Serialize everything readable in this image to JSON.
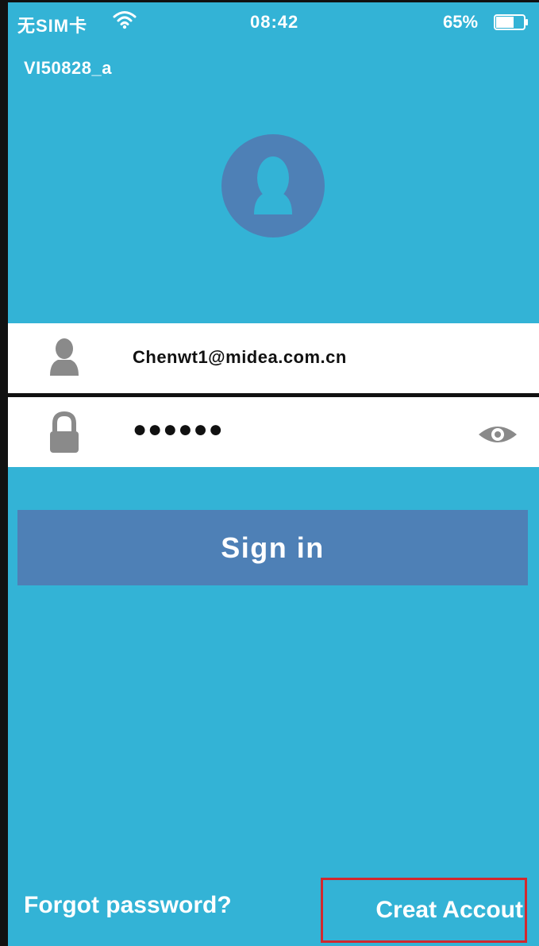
{
  "status_bar": {
    "carrier": "无SIM卡",
    "time": "08:42",
    "battery_percent": "65%",
    "battery_level": 0.65
  },
  "app": {
    "title": "VI50828_a"
  },
  "login": {
    "username_value": "Chenwt1@midea.com.cn",
    "password_masked": "●●●●●●",
    "sign_in_label": "Sign in",
    "forgot_password_label": "Forgot password?",
    "create_account_label": "Creat Accout"
  },
  "icons": {
    "avatar": "user-silhouette-icon",
    "username": "user-icon",
    "password": "lock-icon",
    "show_password": "eye-icon",
    "wifi": "wifi-icon",
    "battery": "battery-icon"
  },
  "colors": {
    "background": "#33b3d6",
    "accent": "#4e80b6",
    "field_background": "#ffffff",
    "icon_gray": "#8a8a8a",
    "highlight_box": "#d2282e"
  }
}
